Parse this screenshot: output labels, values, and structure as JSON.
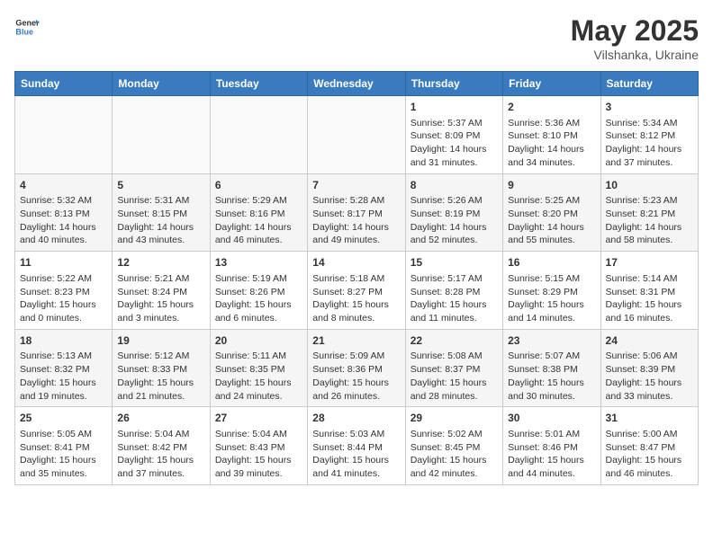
{
  "logo": {
    "general": "General",
    "blue": "Blue"
  },
  "title": "May 2025",
  "subtitle": "Vilshanka, Ukraine",
  "weekdays": [
    "Sunday",
    "Monday",
    "Tuesday",
    "Wednesday",
    "Thursday",
    "Friday",
    "Saturday"
  ],
  "weeks": [
    [
      {
        "day": "",
        "info": ""
      },
      {
        "day": "",
        "info": ""
      },
      {
        "day": "",
        "info": ""
      },
      {
        "day": "",
        "info": ""
      },
      {
        "day": "1",
        "info": "Sunrise: 5:37 AM\nSunset: 8:09 PM\nDaylight: 14 hours\nand 31 minutes."
      },
      {
        "day": "2",
        "info": "Sunrise: 5:36 AM\nSunset: 8:10 PM\nDaylight: 14 hours\nand 34 minutes."
      },
      {
        "day": "3",
        "info": "Sunrise: 5:34 AM\nSunset: 8:12 PM\nDaylight: 14 hours\nand 37 minutes."
      }
    ],
    [
      {
        "day": "4",
        "info": "Sunrise: 5:32 AM\nSunset: 8:13 PM\nDaylight: 14 hours\nand 40 minutes."
      },
      {
        "day": "5",
        "info": "Sunrise: 5:31 AM\nSunset: 8:15 PM\nDaylight: 14 hours\nand 43 minutes."
      },
      {
        "day": "6",
        "info": "Sunrise: 5:29 AM\nSunset: 8:16 PM\nDaylight: 14 hours\nand 46 minutes."
      },
      {
        "day": "7",
        "info": "Sunrise: 5:28 AM\nSunset: 8:17 PM\nDaylight: 14 hours\nand 49 minutes."
      },
      {
        "day": "8",
        "info": "Sunrise: 5:26 AM\nSunset: 8:19 PM\nDaylight: 14 hours\nand 52 minutes."
      },
      {
        "day": "9",
        "info": "Sunrise: 5:25 AM\nSunset: 8:20 PM\nDaylight: 14 hours\nand 55 minutes."
      },
      {
        "day": "10",
        "info": "Sunrise: 5:23 AM\nSunset: 8:21 PM\nDaylight: 14 hours\nand 58 minutes."
      }
    ],
    [
      {
        "day": "11",
        "info": "Sunrise: 5:22 AM\nSunset: 8:23 PM\nDaylight: 15 hours\nand 0 minutes."
      },
      {
        "day": "12",
        "info": "Sunrise: 5:21 AM\nSunset: 8:24 PM\nDaylight: 15 hours\nand 3 minutes."
      },
      {
        "day": "13",
        "info": "Sunrise: 5:19 AM\nSunset: 8:26 PM\nDaylight: 15 hours\nand 6 minutes."
      },
      {
        "day": "14",
        "info": "Sunrise: 5:18 AM\nSunset: 8:27 PM\nDaylight: 15 hours\nand 8 minutes."
      },
      {
        "day": "15",
        "info": "Sunrise: 5:17 AM\nSunset: 8:28 PM\nDaylight: 15 hours\nand 11 minutes."
      },
      {
        "day": "16",
        "info": "Sunrise: 5:15 AM\nSunset: 8:29 PM\nDaylight: 15 hours\nand 14 minutes."
      },
      {
        "day": "17",
        "info": "Sunrise: 5:14 AM\nSunset: 8:31 PM\nDaylight: 15 hours\nand 16 minutes."
      }
    ],
    [
      {
        "day": "18",
        "info": "Sunrise: 5:13 AM\nSunset: 8:32 PM\nDaylight: 15 hours\nand 19 minutes."
      },
      {
        "day": "19",
        "info": "Sunrise: 5:12 AM\nSunset: 8:33 PM\nDaylight: 15 hours\nand 21 minutes."
      },
      {
        "day": "20",
        "info": "Sunrise: 5:11 AM\nSunset: 8:35 PM\nDaylight: 15 hours\nand 24 minutes."
      },
      {
        "day": "21",
        "info": "Sunrise: 5:09 AM\nSunset: 8:36 PM\nDaylight: 15 hours\nand 26 minutes."
      },
      {
        "day": "22",
        "info": "Sunrise: 5:08 AM\nSunset: 8:37 PM\nDaylight: 15 hours\nand 28 minutes."
      },
      {
        "day": "23",
        "info": "Sunrise: 5:07 AM\nSunset: 8:38 PM\nDaylight: 15 hours\nand 30 minutes."
      },
      {
        "day": "24",
        "info": "Sunrise: 5:06 AM\nSunset: 8:39 PM\nDaylight: 15 hours\nand 33 minutes."
      }
    ],
    [
      {
        "day": "25",
        "info": "Sunrise: 5:05 AM\nSunset: 8:41 PM\nDaylight: 15 hours\nand 35 minutes."
      },
      {
        "day": "26",
        "info": "Sunrise: 5:04 AM\nSunset: 8:42 PM\nDaylight: 15 hours\nand 37 minutes."
      },
      {
        "day": "27",
        "info": "Sunrise: 5:04 AM\nSunset: 8:43 PM\nDaylight: 15 hours\nand 39 minutes."
      },
      {
        "day": "28",
        "info": "Sunrise: 5:03 AM\nSunset: 8:44 PM\nDaylight: 15 hours\nand 41 minutes."
      },
      {
        "day": "29",
        "info": "Sunrise: 5:02 AM\nSunset: 8:45 PM\nDaylight: 15 hours\nand 42 minutes."
      },
      {
        "day": "30",
        "info": "Sunrise: 5:01 AM\nSunset: 8:46 PM\nDaylight: 15 hours\nand 44 minutes."
      },
      {
        "day": "31",
        "info": "Sunrise: 5:00 AM\nSunset: 8:47 PM\nDaylight: 15 hours\nand 46 minutes."
      }
    ]
  ]
}
